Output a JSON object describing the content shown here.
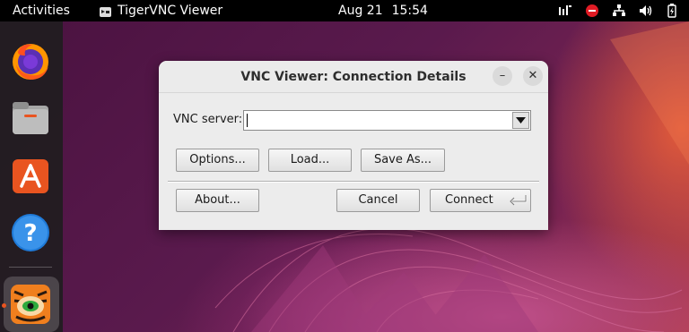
{
  "topbar": {
    "activities": "Activities",
    "app_name": "TigerVNC Viewer",
    "date": "Aug 21",
    "time": "15:54",
    "tray_icons": [
      "accessibility-icon",
      "do-not-disturb-icon",
      "network-icon",
      "volume-icon",
      "battery-icon"
    ]
  },
  "dock": {
    "items": [
      "firefox-icon",
      "files-icon",
      "app-center-icon",
      "help-icon",
      "tigervnc-icon"
    ],
    "active_app": "tigervnc-icon"
  },
  "dialog": {
    "title": "VNC Viewer: Connection Details",
    "server_label": "VNC server:",
    "server_value": "",
    "buttons": {
      "options": "Options...",
      "load": "Load...",
      "save_as": "Save As...",
      "about": "About...",
      "cancel": "Cancel",
      "connect": "Connect"
    },
    "window_controls": {
      "minimize": "–",
      "close": "✕"
    }
  },
  "colors": {
    "accent": "#e95420",
    "topbar": "#000000",
    "dialog_bg": "#ececec"
  }
}
